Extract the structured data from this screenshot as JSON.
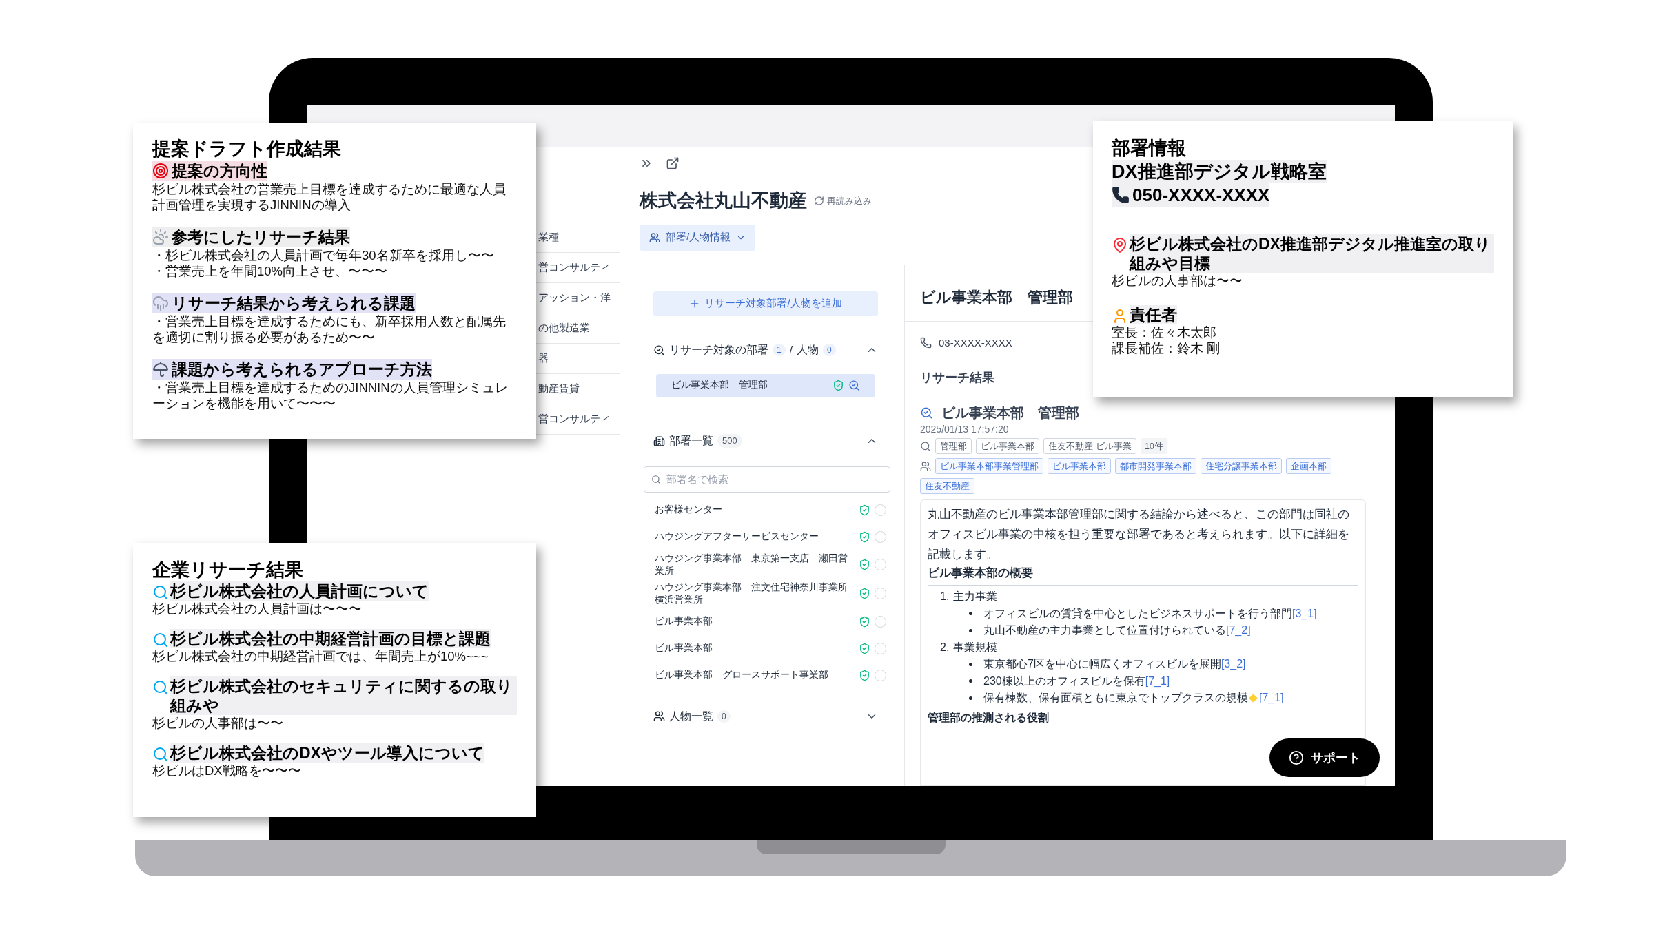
{
  "sidebar": {
    "items": [
      "業種",
      "営コンサルティ",
      "アッション・洋",
      "の他製造業",
      "器",
      "動産賃貸",
      "営コンサルティ"
    ]
  },
  "company": {
    "name": "株式会社丸山不動産",
    "reload": "再読み込み",
    "view_menu": "部署/人物情報"
  },
  "research_targets": {
    "add_button": "リサーチ対象部署/人物を追加",
    "label_departments": "リサーチ対象の部署",
    "department_count": "1",
    "separator": "/",
    "label_people": "人物",
    "people_count": "0",
    "expanded": true,
    "items": [
      {
        "name": "ビル事業本部　管理部",
        "selected": true
      }
    ]
  },
  "department_list": {
    "title": "部署一覧",
    "count": "500",
    "expanded": true,
    "search": {
      "placeholder": "部署名で検索"
    },
    "items": [
      {
        "name": "お客様センター",
        "selected": false
      },
      {
        "name": "ハウジングアフターサービスセンター",
        "selected": false
      },
      {
        "name": "ハウジング事業本部　東京第一支店　瀬田営業所",
        "selected": false
      },
      {
        "name": "ハウジング事業本部　注文住宅神奈川事業所横浜営業所",
        "selected": false
      },
      {
        "name": "ビル事業本部",
        "selected": false
      },
      {
        "name": "ビル事業本部",
        "selected": false
      },
      {
        "name": "ビル事業本部　グロースサポート事業部",
        "selected": false
      }
    ]
  },
  "people_list": {
    "title": "人物一覧",
    "count": "0",
    "expanded": false
  },
  "detail": {
    "title": "ビル事業本部　管理部",
    "phone": "03-XXXX-XXXX",
    "results_heading": "リサーチ結果",
    "result": {
      "title": "ビル事業本部　管理部",
      "timestamp": "2025/01/13 17:57:20",
      "keywords": [
        "管理部",
        "ビル事業本部",
        "住友不動産 ビル事業"
      ],
      "keyword_count": "10件",
      "departments": [
        "ビル事業本部事業管理部",
        "ビル事業本部",
        "都市開発事業本部",
        "住宅分譲事業本部",
        "企画本部",
        "住友不動産"
      ],
      "summary": "丸山不動産のビル事業本部管理部に関する結論から述べると、この部門は同社のオフィスビル事業の中核を担う重要な部署であると考えられます。以下に詳細を記載します。",
      "overview_heading": "ビル事業本部の概要",
      "groups": [
        {
          "number": "1.",
          "title": "主力事業",
          "points": [
            {
              "text": "オフィスビルの賃貸を中心としたビジネスサポートを行う部門",
              "ref": "[3_1]",
              "kind": "plain"
            },
            {
              "text": "丸山不動産の主力事業として位置付けられている",
              "ref": "[7_2]",
              "kind": "plain"
            }
          ]
        },
        {
          "number": "2.",
          "title": "事業規模",
          "points": [
            {
              "text": "東京都心7区を中心に幅広くオフィスビルを展開",
              "ref": "[3_2]",
              "kind": "plain"
            },
            {
              "text": "230棟以上のオフィスビルを保有",
              "ref": "[7_1]",
              "kind": "plain"
            },
            {
              "text": "保有棟数、保有面積ともに東京でトップクラスの規模",
              "ref": "[7_1]",
              "kind": "flagged"
            }
          ]
        }
      ],
      "next_heading": "管理部の推測される役割"
    }
  },
  "support_button": "サポート",
  "proposal_card": {
    "title": "提案ドラフト作成結果",
    "sections": [
      {
        "heading": "提案の方向性",
        "color": "#f6dde3",
        "lines": [
          "杉ビル株式会社の営業売上目標を達成するために最適な人員計画管理を実現するJINNINの導入"
        ]
      },
      {
        "heading": "参考にしたリサーチ結果",
        "color": "#eeeeef",
        "lines": [
          "・杉ビル株式会社の人員計画で毎年30名新卒を採用し〜〜",
          "・営業売上を年間10%向上させ、〜〜〜"
        ]
      },
      {
        "heading": "リサーチ結果から考えられる課題",
        "color": "#e2e2f6",
        "lines": [
          "・営業売上目標を達成するためにも、新卒採用人数と配属先を適切に割り振る必要があるため〜〜"
        ]
      },
      {
        "heading": "課題から考えられるアプローチ方法",
        "color": "#e2e2f6",
        "lines": [
          "・営業売上目標を達成するためのJINNINの人員管理シミュレーションを機能を用いて〜〜〜"
        ]
      }
    ]
  },
  "research_card": {
    "title": "企業リサーチ結果",
    "sections": [
      {
        "heading": "杉ビル株式会社の人員計画について",
        "body": "杉ビル株式会社の人員計画は〜〜〜"
      },
      {
        "heading": "杉ビル株式会社の中期経営計画の目標と課題",
        "body": "杉ビル株式会社の中期経営計画では、年間売上が10%~~~"
      },
      {
        "heading": "杉ビル株式会社のセキュリティに関するの取り組みや",
        "body": "杉ビルの人事部は〜〜"
      },
      {
        "heading": "杉ビル株式会社のDXやツール導入について",
        "body": "杉ビルはDX戦略を〜〜〜"
      }
    ]
  },
  "department_card": {
    "title": "部署情報",
    "department": "DX推進部デジタル戦略室",
    "phone": "050-XXXX-XXXX",
    "sections": [
      {
        "heading": "杉ビル株式会社のDX推進部デジタル推進室の取り組みや目標",
        "lines": [
          "杉ビルの人事部は〜〜"
        ]
      },
      {
        "heading": "責任者",
        "lines": [
          "室長：佐々木太郎",
          "課長補佐：鈴木 剛"
        ]
      }
    ]
  }
}
